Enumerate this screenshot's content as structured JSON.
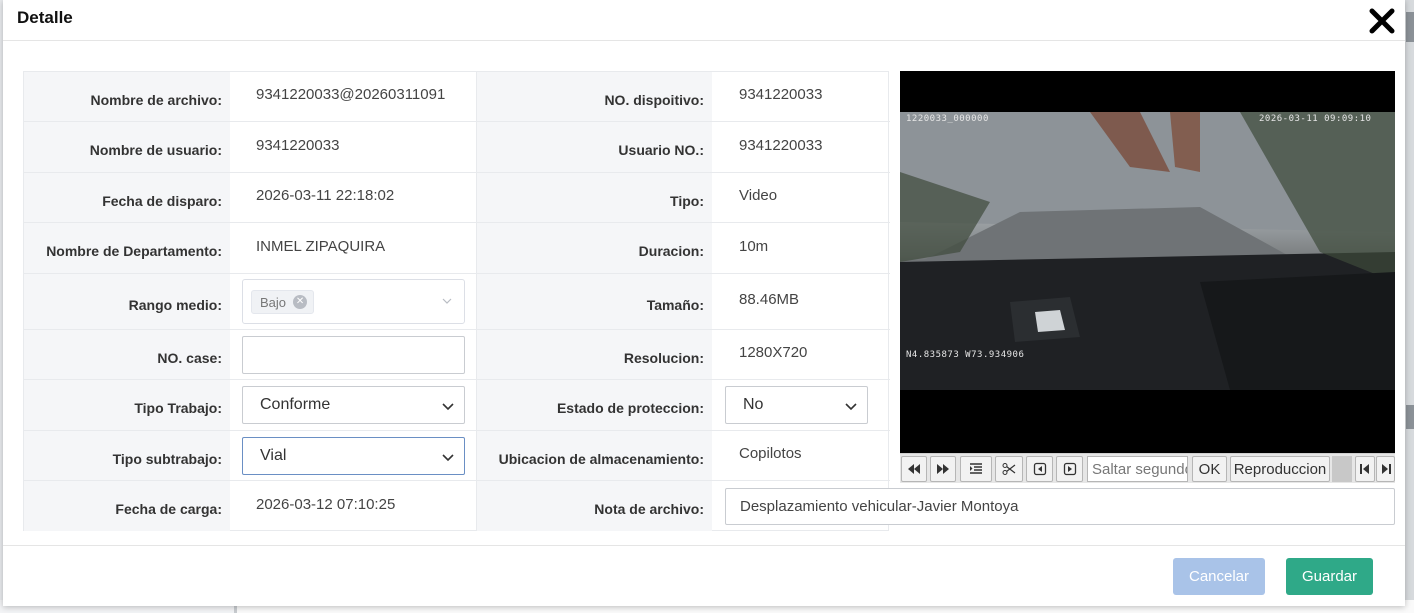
{
  "dialog": {
    "title": "Detalle",
    "close_icon": "close-icon"
  },
  "fields": {
    "file_name": {
      "label": "Nombre de archivo:",
      "value": "9341220033@20260311091"
    },
    "device_no": {
      "label": "NO. dispoitivo:",
      "value": "9341220033"
    },
    "user_name": {
      "label": "Nombre de usuario:",
      "value": "9341220033"
    },
    "user_no": {
      "label": "Usuario NO.:",
      "value": "9341220033"
    },
    "trigger_date": {
      "label": "Fecha de disparo:",
      "value": "2026-03-11 22:18:02"
    },
    "type": {
      "label": "Tipo:",
      "value": "Video"
    },
    "department": {
      "label": "Nombre de Departamento:",
      "value": "INMEL ZIPAQUIRA"
    },
    "duration": {
      "label": "Duracion:",
      "value": "10m"
    },
    "range": {
      "label": "Rango medio:",
      "tag": "Bajo"
    },
    "size": {
      "label": "Tamaño:",
      "value": "88.46MB"
    },
    "case_no": {
      "label": "NO. case:",
      "value": ""
    },
    "resolution": {
      "label": "Resolucion:",
      "value": "1280X720"
    },
    "work_type": {
      "label": "Tipo Trabajo:",
      "value": "Conforme"
    },
    "protection": {
      "label": "Estado de proteccion:",
      "value": "No"
    },
    "subwork_type": {
      "label": "Tipo subtrabajo:",
      "value": "Vial"
    },
    "storage": {
      "label": "Ubicacion de almacenamiento:",
      "value": "Copilotos"
    },
    "upload_date": {
      "label": "Fecha de carga:",
      "value": "2026-03-12 07:10:25"
    },
    "file_note": {
      "label": "Nota de archivo:",
      "value": "Desplazamiento vehicular-Javier Montoya"
    }
  },
  "video": {
    "osd_id": "1220033_000000",
    "osd_time": "2026-03-11 09:09:10",
    "osd_gps": "N4.835873  W73.934906",
    "controls": {
      "rewind_icon": "rewind-icon",
      "fast_forward_icon": "fast-forward-icon",
      "list_icon": "list-icon",
      "scissors_icon": "scissors-icon",
      "prev_frame_icon": "prev-frame-icon",
      "next_frame_icon": "next-frame-icon",
      "jump_placeholder": "Saltar segundos",
      "ok_label": "OK",
      "playback_label": "Reproduccion",
      "first_icon": "skip-start-icon",
      "last_icon": "skip-end-icon"
    }
  },
  "footer": {
    "cancel_label": "Cancelar",
    "save_label": "Guardar"
  },
  "colors": {
    "save": "#2fa988",
    "cancel": "#a9c3e8",
    "label_bg": "#f5f6f8"
  }
}
